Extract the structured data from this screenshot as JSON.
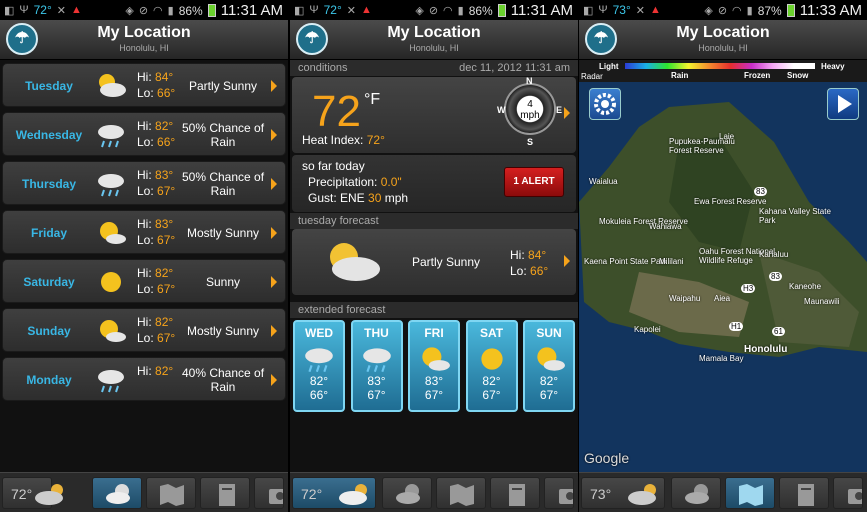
{
  "status_bars": [
    {
      "temp": "72°",
      "battery": "86%",
      "time": "11:31 AM"
    },
    {
      "temp": "72°",
      "battery": "86%",
      "time": "11:31 AM"
    },
    {
      "temp": "73°",
      "battery": "87%",
      "time": "11:33 AM"
    }
  ],
  "header": {
    "title": "My Location",
    "subtitle": "Honolulu, HI"
  },
  "days": [
    {
      "name": "Tuesday",
      "hi": "84°",
      "lo": "66°",
      "cond": "Partly Sunny",
      "icon": "partly-sunny-icon"
    },
    {
      "name": "Wednesday",
      "hi": "82°",
      "lo": "66°",
      "cond": "50% Chance of Rain",
      "icon": "rain-icon"
    },
    {
      "name": "Thursday",
      "hi": "83°",
      "lo": "67°",
      "cond": "50% Chance of Rain",
      "icon": "rain-icon"
    },
    {
      "name": "Friday",
      "hi": "83°",
      "lo": "67°",
      "cond": "Mostly Sunny",
      "icon": "mostly-sunny-icon"
    },
    {
      "name": "Saturday",
      "hi": "82°",
      "lo": "67°",
      "cond": "Sunny",
      "icon": "sunny-icon"
    },
    {
      "name": "Sunday",
      "hi": "82°",
      "lo": "67°",
      "cond": "Mostly Sunny",
      "icon": "mostly-sunny-icon"
    },
    {
      "name": "Monday",
      "hi": "82°",
      "lo": "",
      "cond": "40% Chance of Rain",
      "icon": "rain-icon"
    }
  ],
  "labels": {
    "hi": "Hi:",
    "lo": "Lo:"
  },
  "conditions": {
    "section": "conditions",
    "date": "dec 11, 2012 11:31 am",
    "temp": "72",
    "unit": "°F",
    "heat_index_label": "Heat Index:",
    "heat_index": "72°",
    "wind_speed": "4",
    "wind_unit": "mph",
    "compass": {
      "n": "N",
      "e": "E",
      "s": "S",
      "w": "W"
    }
  },
  "so_far": {
    "title": "so far today",
    "precip_label": "Precipitation:",
    "precip": "0.0\"",
    "gust_label": "Gust: ENE",
    "gust": "30",
    "gust_unit": "mph",
    "alert": "1 ALERT"
  },
  "tuesday_forecast": {
    "section": "tuesday forecast",
    "cond": "Partly Sunny",
    "hi": "84°",
    "lo": "66°"
  },
  "extended": {
    "section": "extended forecast",
    "days": [
      {
        "name": "WED",
        "hi": "82°",
        "lo": "66°",
        "icon": "rain-icon"
      },
      {
        "name": "THU",
        "hi": "83°",
        "lo": "67°",
        "icon": "rain-icon"
      },
      {
        "name": "FRI",
        "hi": "83°",
        "lo": "67°",
        "icon": "mostly-sunny-icon"
      },
      {
        "name": "SAT",
        "hi": "82°",
        "lo": "67°",
        "icon": "sunny-icon"
      },
      {
        "name": "SUN",
        "hi": "82°",
        "lo": "67°",
        "icon": "mostly-sunny-icon"
      }
    ]
  },
  "bottom_bars": [
    {
      "temp": "72°"
    },
    {
      "temp": "72°"
    },
    {
      "temp": "73°"
    }
  ],
  "radar": {
    "radar_label": "Radar",
    "light": "Light",
    "heavy": "Heavy",
    "rain": "Rain",
    "frozen": "Frozen",
    "snow": "Snow",
    "places": [
      "Pupukea-Paumalu Forest Reserve",
      "Laie",
      "Waialua",
      "Ewa Forest Reserve",
      "Kahana Valley State Park",
      "Mokuleia Forest Reserve",
      "Wahiawa",
      "Kaena Point State Park",
      "Mililani",
      "Oahu Forest National Wildlife Refuge",
      "Kahaluu",
      "Kaneohe",
      "Maunawili",
      "Waipahu",
      "Aiea",
      "Kapolei",
      "Honolulu",
      "Mamala Bay",
      "Google"
    ],
    "shields": [
      "83",
      "83",
      "H3",
      "H1",
      "61"
    ]
  },
  "colors": {
    "accent": "#39b7e5",
    "orange": "#f6a31b",
    "alert": "#c81919"
  }
}
